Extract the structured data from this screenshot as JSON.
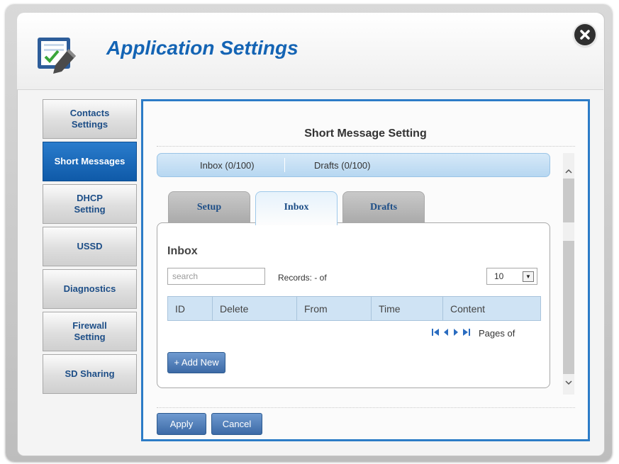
{
  "dialog": {
    "title": "Application Settings",
    "icon": "checklist-pencil-icon",
    "close_icon": "close-icon"
  },
  "sidebar": {
    "items": [
      {
        "label_line1": "Contacts",
        "label_line2": "Settings",
        "active": false
      },
      {
        "label_line1": "Short Messages",
        "label_line2": "",
        "active": true
      },
      {
        "label_line1": "DHCP",
        "label_line2": "Setting",
        "active": false
      },
      {
        "label_line1": "USSD",
        "label_line2": "",
        "active": false
      },
      {
        "label_line1": "Diagnostics",
        "label_line2": "",
        "active": false
      },
      {
        "label_line1": "Firewall",
        "label_line2": "Setting",
        "active": false
      },
      {
        "label_line1": "SD Sharing",
        "label_line2": "",
        "active": false
      }
    ]
  },
  "main": {
    "section_title": "Short Message Setting",
    "summary": {
      "inbox": "Inbox (0/100)",
      "drafts": "Drafts (0/100)"
    },
    "tabs": [
      {
        "label": "Setup"
      },
      {
        "label": "Inbox"
      },
      {
        "label": "Drafts"
      }
    ],
    "active_tab": "Inbox",
    "panel": {
      "title": "Inbox",
      "search_placeholder": "search",
      "records_text": "Records: - of",
      "page_size": "10",
      "columns": [
        "ID",
        "Delete",
        "From",
        "Time",
        "Content"
      ],
      "rows": [],
      "pages_text": "Pages of",
      "add_new_label": "+ Add New"
    },
    "scroll_up_glyph": "^",
    "scroll_down_glyph": "v",
    "apply_label": "Apply",
    "cancel_label": "Cancel"
  },
  "colors": {
    "accent": "#1464b4",
    "active_nav": "#1a6bbd",
    "content_border": "#2c7cc7",
    "button": "#4a78b3"
  }
}
